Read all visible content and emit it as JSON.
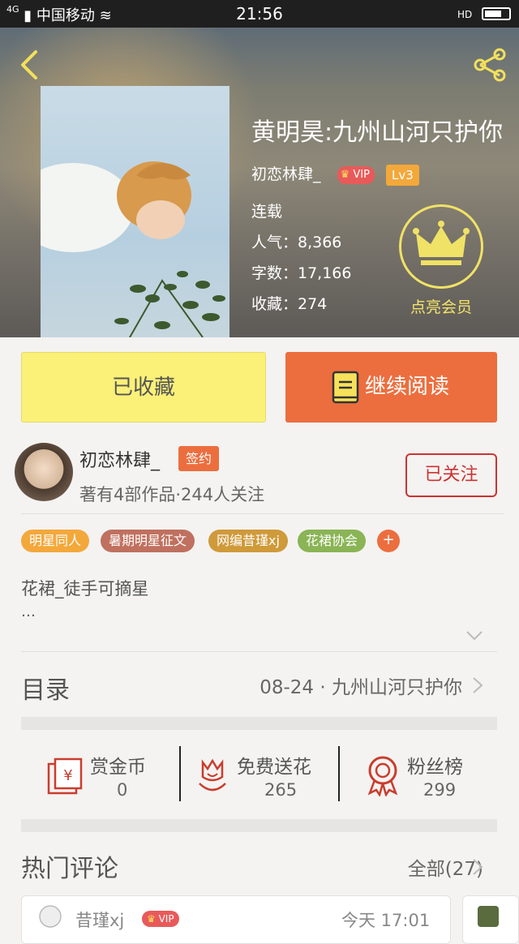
{
  "status_bar": {
    "network": "4G",
    "carrier": "中国移动",
    "time": "21:56",
    "hd": "HD"
  },
  "book": {
    "title": "黄明昊:九州山河只护你",
    "author": "初恋林肆_",
    "vip": "VIP",
    "level": "Lv3",
    "state": "连载",
    "popularity": "人气：8,366",
    "word_count": "字数：17,166",
    "favorites": "收藏：274",
    "member_label": "点亮会员"
  },
  "actions": {
    "favorited": "已收藏",
    "continue_reading": "继续阅读"
  },
  "author_card": {
    "name": "初恋林肆_",
    "badge": "签约",
    "info": "著有4部作品·244人关注",
    "follow": "已关注"
  },
  "tags": [
    {
      "label": "明星同人",
      "color": "#f3a83b"
    },
    {
      "label": "暑期明星征文",
      "color": "#c0705f"
    },
    {
      "label": "网编昔瑾xj",
      "color": "#cf9a3a"
    },
    {
      "label": "花裙协会",
      "color": "#8ab455"
    }
  ],
  "tag_add": "+",
  "intro": {
    "text": "花裙_徒手可摘星",
    "ellipsis": "…"
  },
  "toc": {
    "label": "目录",
    "latest": "08-24 · 九州山河只护你"
  },
  "stats": [
    {
      "label": "赏金币",
      "value": "0",
      "icon": "reward-coin-icon"
    },
    {
      "label": "免费送花",
      "value": "265",
      "icon": "flower-icon"
    },
    {
      "label": "粉丝榜",
      "value": "299",
      "icon": "medal-icon"
    }
  ],
  "comments": {
    "header": "热门评论",
    "all": "全部(27)",
    "first": {
      "name": "昔瑾xj",
      "vip": "VIP",
      "time": "今天 17:01"
    }
  },
  "colors": {
    "accent_orange": "#ec6e3f",
    "fav_yellow": "#fbf078",
    "follow_red": "#cc3333",
    "crown_yellow": "#f0e266"
  }
}
